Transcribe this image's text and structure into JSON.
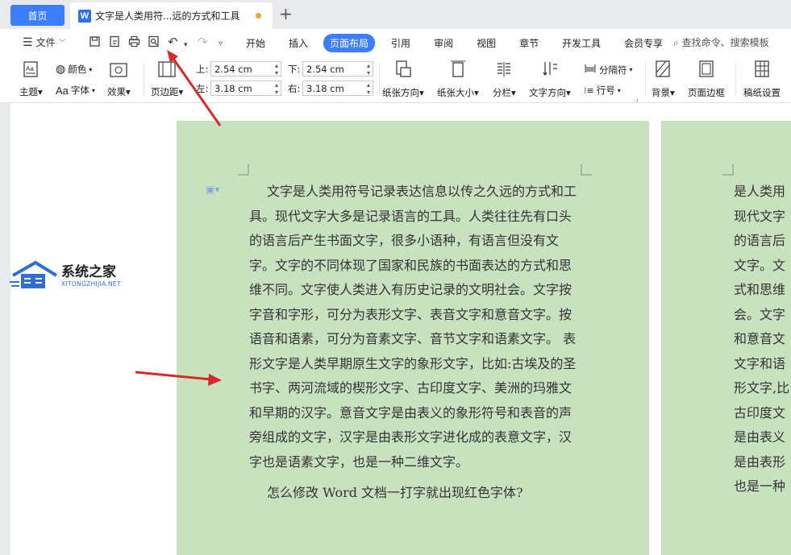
{
  "tabs": {
    "home": "首页",
    "doc_icon": "W",
    "doc_title": "文字是人类用符...远的方式和工具",
    "new_tab": "+"
  },
  "menubar": {
    "file_menu": "文件",
    "items": [
      "开始",
      "插入",
      "页面布局",
      "引用",
      "审阅",
      "视图",
      "章节",
      "开发工具",
      "会员专享"
    ],
    "active_item": "页面布局",
    "search_placeholder": "查找命令、搜索模板"
  },
  "ribbon": {
    "theme": "主题",
    "color": "颜色",
    "font": "字体",
    "effects": "效果",
    "margins": "页边距",
    "margin_top_label": "上:",
    "margin_top_value": "2.54 cm",
    "margin_bottom_label": "下:",
    "margin_bottom_value": "2.54 cm",
    "margin_left_label": "左:",
    "margin_left_value": "3.18 cm",
    "margin_right_label": "右:",
    "margin_right_value": "3.18 cm",
    "orientation": "纸张方向",
    "size": "纸张大小",
    "columns": "分栏",
    "text_direction": "文字方向",
    "breaks": "分隔符",
    "line_numbers": "行号",
    "background": "背景",
    "page_border": "页面边框",
    "draft_settings": "稿纸设置"
  },
  "document": {
    "paragraph": "文字是人类用符号记录表达信息以传之久远的方式和工具。现代文字大多是记录语言的工具。人类往往先有口头的语言后产生书面文字，很多小语种，有语言但没有文字。文字的不同体现了国家和民族的书面表达的方式和思维不同。文字使人类进入有历史记录的文明社会。文字按字音和字形，可分为表形文字、表音文字和意音文字。按语音和语素，可分为音素文字、音节文字和语素文字。 表形文字是人类早期原生文字的象形文字，比如:古埃及的圣书字、两河流域的楔形文字、古印度文字、美洲的玛雅文和早期的汉字。意音文字是由表义的象形符号和表音的声旁组成的文字，汉字是由表形文字进化成的表意文字，汉字也是语素文字，也是一种二维文字。",
    "question": "怎么修改 Word 文档一打字就出现红色字体?",
    "page2_lines": [
      "是人类用",
      "现代文字",
      "的语言后",
      "文字。文",
      "式和思维",
      "会。文字",
      "和意音文",
      "文字和语",
      "形文字,比",
      "古印度文",
      "是由表义",
      "是由表形",
      "也是一种"
    ]
  },
  "watermark": {
    "name": "系统之家",
    "url": "XITONGZHIJIA.NET"
  },
  "colors": {
    "accent": "#3d7dff",
    "page_background": "#c8e2bf",
    "arrow": "#d62a2a"
  }
}
